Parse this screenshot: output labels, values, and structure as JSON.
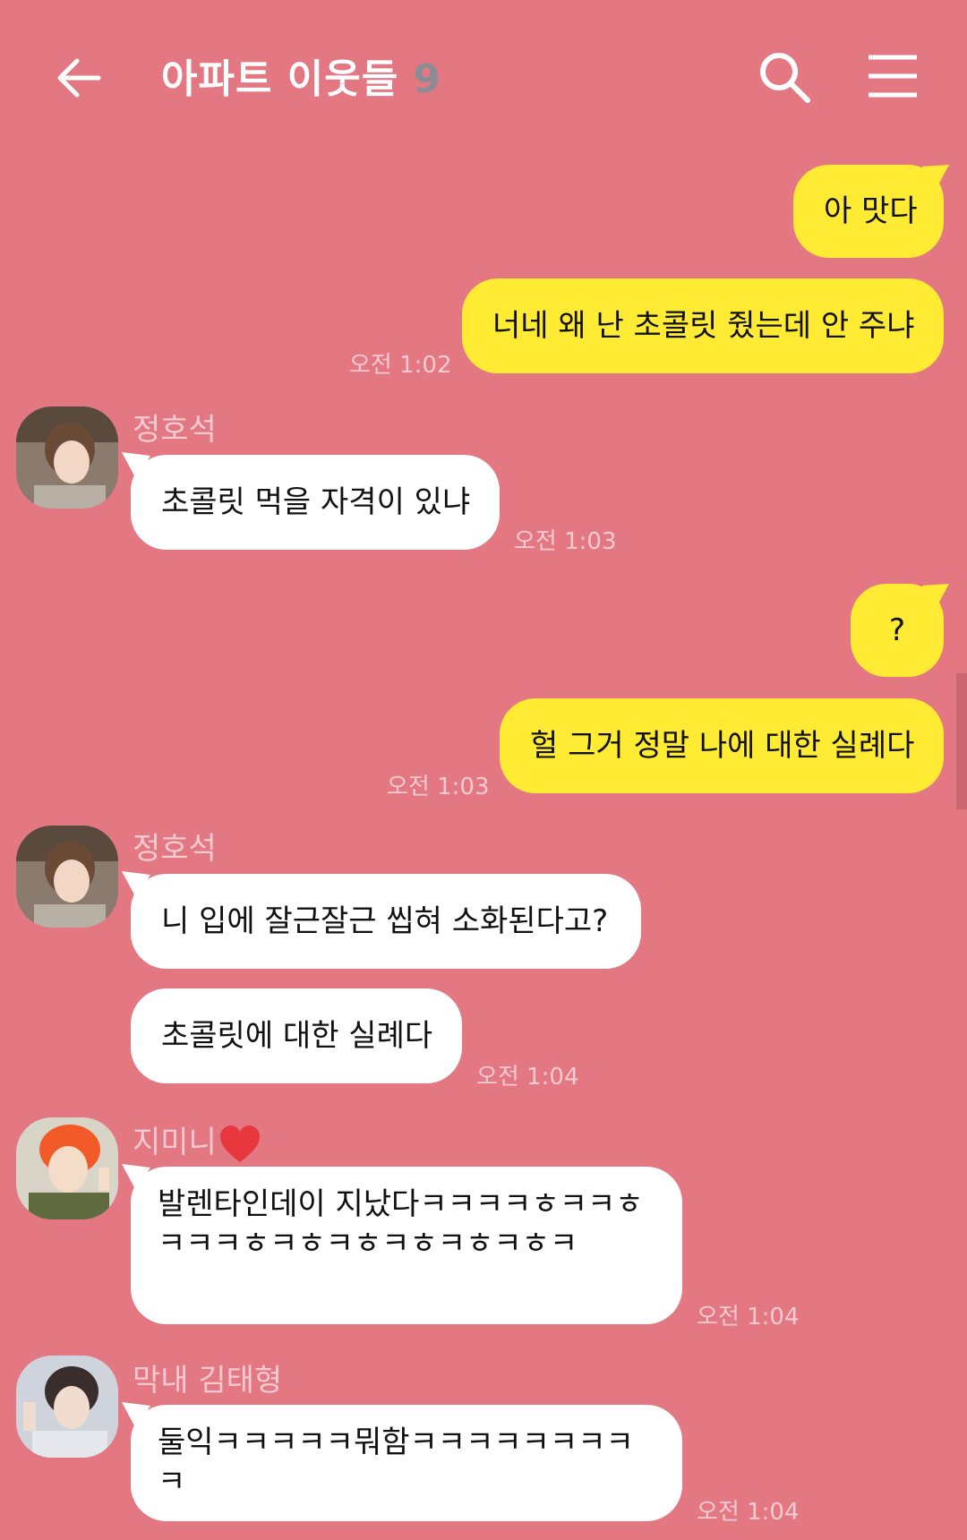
{
  "header": {
    "title": "아파트 이웃들",
    "member_count": "9",
    "back_icon": "arrow-left-icon",
    "search_icon": "search-icon",
    "menu_icon": "hamburger-menu-icon"
  },
  "colors": {
    "background": "#e37883",
    "my_bubble": "#ffeb33",
    "other_bubble": "#ffffff",
    "meta_text": "#f6cad0"
  },
  "messages": [
    {
      "sender": "me",
      "text": "아 맛다"
    },
    {
      "sender": "me",
      "text": "너네 왜 난 초콜릿 줬는데 안 주냐",
      "time": "오전 1:02"
    },
    {
      "sender": "정호석",
      "text": "초콜릿 먹을 자격이 있냐",
      "time": "오전 1:03"
    },
    {
      "sender": "me",
      "text": "?"
    },
    {
      "sender": "me",
      "text": "헐 그거 정말 나에 대한 실례다",
      "time": "오전 1:03"
    },
    {
      "sender": "정호석",
      "text": "니 입에 잘근잘근 씹혀 소화된다고?"
    },
    {
      "sender": "정호석",
      "text": "초콜릿에 대한 실례다",
      "time": "오전 1:04"
    },
    {
      "sender": "지미니",
      "name_icon": "red-heart-icon",
      "text": "발렌타인데이 지났다ㅋㅋㅋㅋㅎㅋㅋㅎㅋㅋㅋㅎㅋㅎㅋㅎㅋㅎㅋㅎㅋㅎㅋ",
      "time": "오전 1:04"
    },
    {
      "sender": "막내 김태형",
      "text": "둘익ㅋㅋㅋㅋㅋ뭐함ㅋㅋㅋㅋㅋㅋㅋㅋㅋ",
      "time": "오전 1:04"
    }
  ]
}
